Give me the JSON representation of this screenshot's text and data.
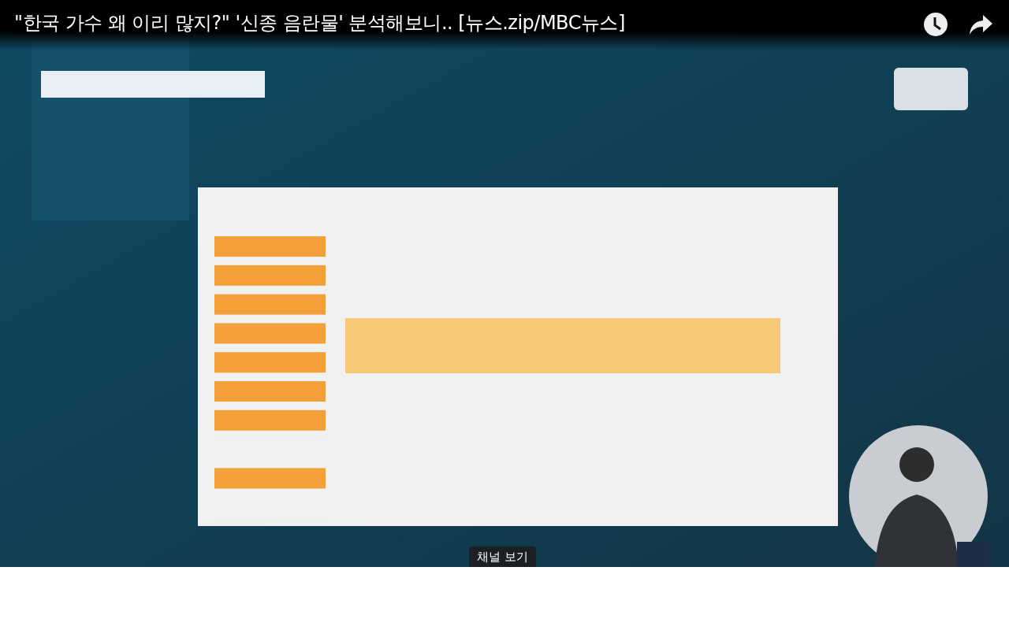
{
  "player": {
    "title": "\"한국 가수 왜 이리 많지?\" '신종 음란물' 분석해보니.. [뉴스.zip/MBC뉴스]",
    "overlay_button": "채널 보기"
  }
}
